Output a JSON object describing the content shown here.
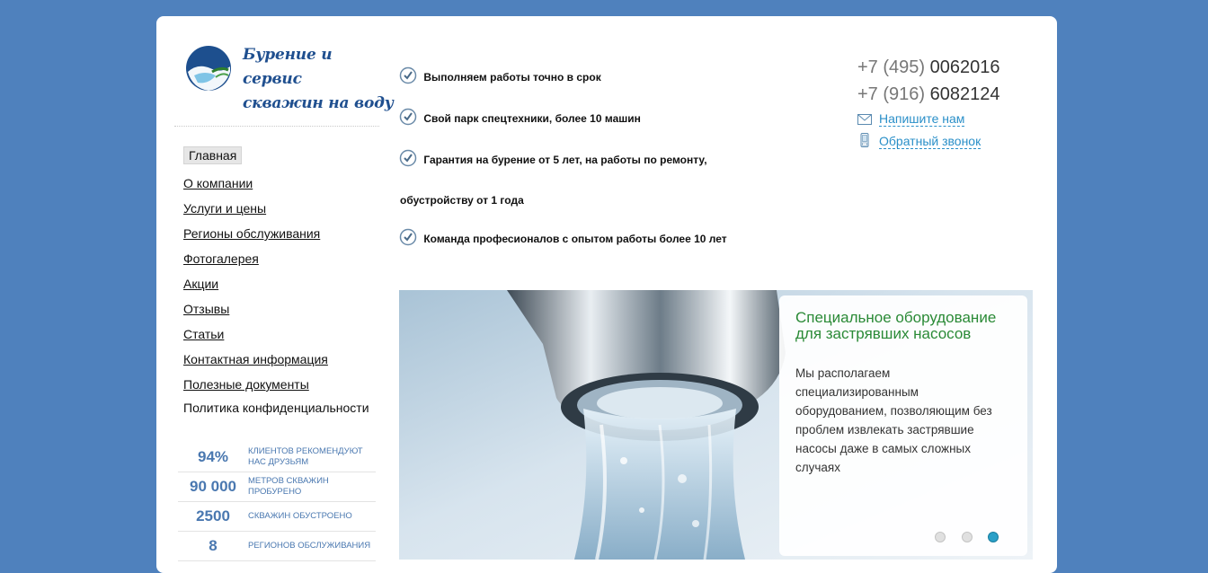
{
  "brand": {
    "logo_line1": "Бурение и сервис",
    "logo_line2": "скважин на воду"
  },
  "nav": {
    "items": [
      {
        "label": "Главная",
        "active": true
      },
      {
        "label": "О компании"
      },
      {
        "label": "Услуги и цены"
      },
      {
        "label": "Регионы обслуживания"
      },
      {
        "label": "Фотогалерея"
      },
      {
        "label": "Акции"
      },
      {
        "label": "Отзывы"
      },
      {
        "label": "Статьи"
      },
      {
        "label": "Контактная информация"
      },
      {
        "label": "Полезные документы"
      },
      {
        "label": "Политика конфиденциальности"
      }
    ]
  },
  "stats": [
    {
      "value": "94%",
      "label": "клиентов рекомендуют нас друзьям"
    },
    {
      "value": "90 000",
      "label": "метров скважин пробурено"
    },
    {
      "value": "2500",
      "label": "скважин обустроено"
    },
    {
      "value": "8",
      "label": "регионов обслуживания"
    }
  ],
  "features": [
    "Выполняем работы точно в срок",
    "Свой парк спецтехники, более 10 машин",
    "Гарантия на бурение от 5 лет, на работы по ремонту,",
    "обустройству от 1 года",
    "Команда професионалов с опытом работы более 10 лет"
  ],
  "contacts": {
    "phone1_code": "+7 (495)",
    "phone1_number": "0062016",
    "phone2_code": "+7 (916)",
    "phone2_number": "6082124",
    "write_us": "Напишите нам",
    "callback": "Обратный звонок"
  },
  "slider": {
    "title": "Специальное оборудование для застрявших насосов",
    "text": "Мы располагаем специализированным оборудованием, позволяющим без проблем извлекать застрявшие насосы даже в самых сложных случаях",
    "slides_count": 3,
    "active_slide": 3
  },
  "colors": {
    "background": "#4f81bd",
    "accent_green": "#2a8a36",
    "link_blue": "#2a8fc8",
    "stat_blue": "#4a78b0"
  }
}
